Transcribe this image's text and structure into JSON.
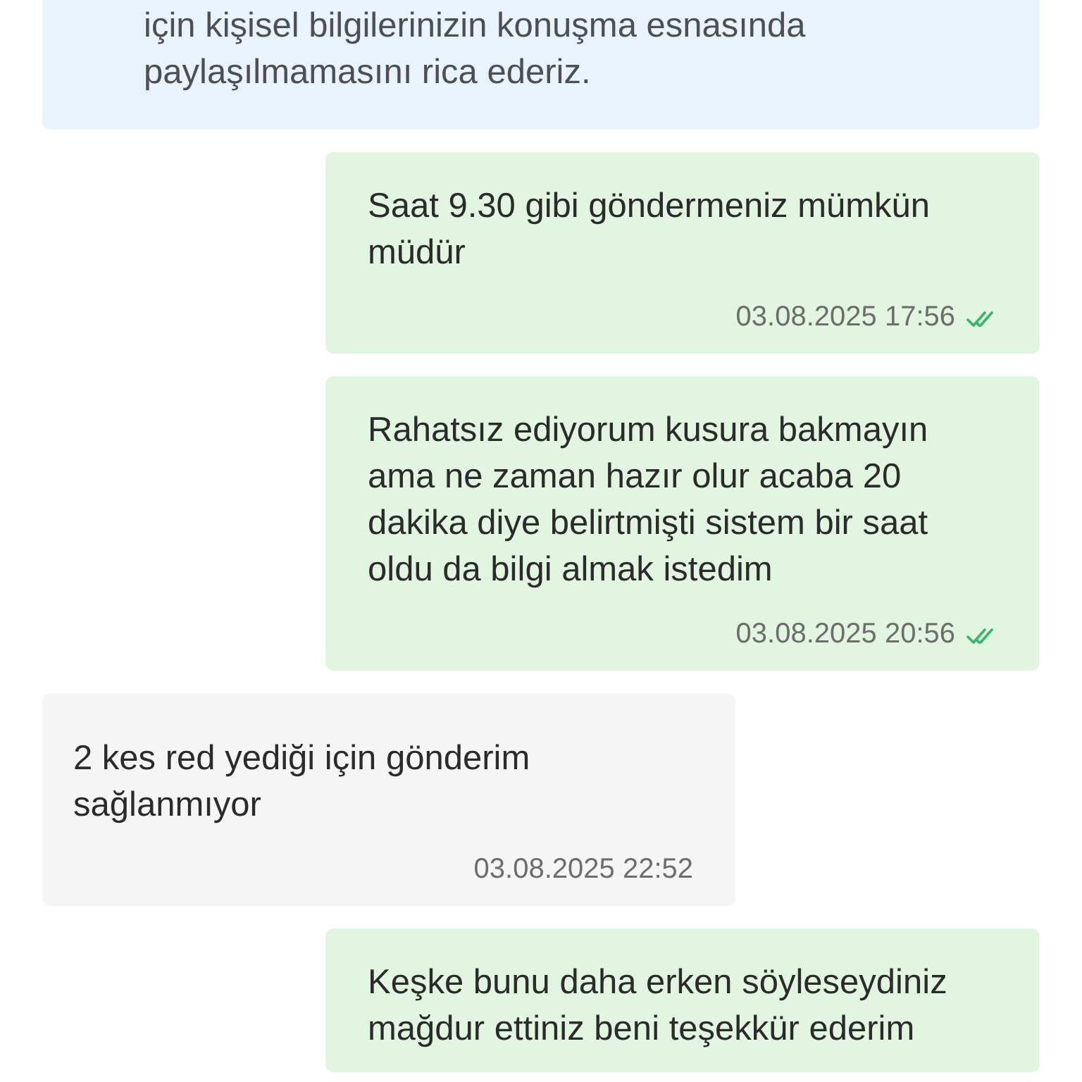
{
  "messages": [
    {
      "kind": "notice",
      "text": "için kişisel bilgilerinizin konuşma esnasında paylaşılmamasını rica ederiz."
    },
    {
      "kind": "outgoing",
      "text": "Saat 9.30 gibi göndermeniz mümkün müdür",
      "time": "03.08.2025 17:56",
      "read": true
    },
    {
      "kind": "outgoing",
      "text": "Rahatsız ediyorum kusura bakmayın ama ne zaman hazır olur acaba 20 dakika diye belirtmişti sistem bir saat oldu da bilgi almak istedim",
      "time": "03.08.2025 20:56",
      "read": true
    },
    {
      "kind": "incoming",
      "text": "2 kes red yediği için gönderim sağlanmıyor",
      "time": "03.08.2025 22:52"
    },
    {
      "kind": "outgoing",
      "text": "Keşke bunu daha erken söyleseydiniz mağdur ettiniz beni teşekkür ederim"
    }
  ]
}
